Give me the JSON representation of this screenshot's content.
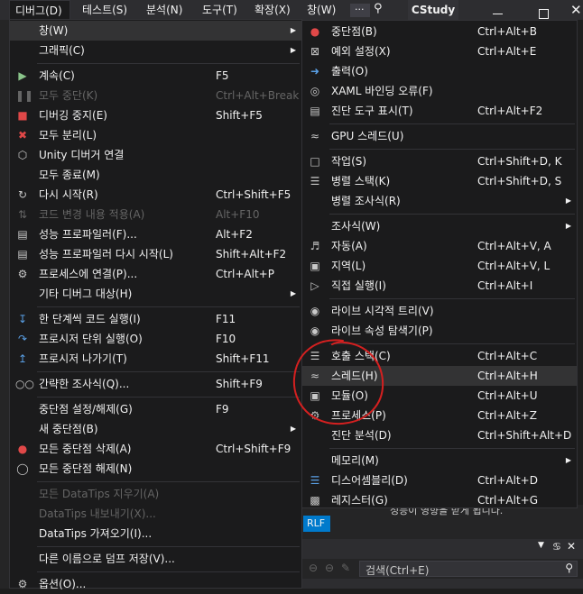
{
  "menubar": {
    "items": [
      {
        "label": "디버그(D)"
      },
      {
        "label": "테스트(S)"
      },
      {
        "label": "분석(N)"
      },
      {
        "label": "도구(T)"
      },
      {
        "label": "확장(X)"
      },
      {
        "label": "창(W)"
      }
    ],
    "search_ellipsis": "...",
    "solution_title": "CStudy"
  },
  "debug_menu": {
    "items": [
      {
        "label": "창(W)",
        "shortcut": "",
        "icon": "",
        "submenu": true,
        "highlight": true
      },
      {
        "label": "그래픽(C)",
        "shortcut": "",
        "icon": "",
        "submenu": true
      },
      {
        "sep": true
      },
      {
        "label": "계속(C)",
        "shortcut": "F5",
        "icon": "play-icon"
      },
      {
        "label": "모두 중단(K)",
        "shortcut": "Ctrl+Alt+Break",
        "icon": "pause-icon",
        "disabled": true
      },
      {
        "label": "디버깅 중지(E)",
        "shortcut": "Shift+F5",
        "icon": "stop-icon"
      },
      {
        "label": "모두 분리(L)",
        "shortcut": "",
        "icon": "detach-icon"
      },
      {
        "label": "Unity 디버거 연결",
        "shortcut": "",
        "icon": "unity-icon"
      },
      {
        "label": "모두 종료(M)",
        "shortcut": "",
        "icon": ""
      },
      {
        "label": "다시 시작(R)",
        "shortcut": "Ctrl+Shift+F5",
        "icon": "restart-icon"
      },
      {
        "label": "코드 변경 내용 적용(A)",
        "shortcut": "Alt+F10",
        "icon": "apply-changes-icon",
        "disabled": true
      },
      {
        "label": "성능 프로파일러(F)...",
        "shortcut": "Alt+F2",
        "icon": "profiler-icon"
      },
      {
        "label": "성능 프로파일러 다시 시작(L)",
        "shortcut": "Shift+Alt+F2",
        "icon": "profiler-restart-icon"
      },
      {
        "label": "프로세스에 연결(P)...",
        "shortcut": "Ctrl+Alt+P",
        "icon": "attach-process-icon"
      },
      {
        "label": "기타 디버그 대상(H)",
        "shortcut": "",
        "icon": "",
        "submenu": true
      },
      {
        "sep": true
      },
      {
        "label": "한 단계씩 코드 실행(I)",
        "shortcut": "F11",
        "icon": "step-into-icon"
      },
      {
        "label": "프로시저 단위 실행(O)",
        "shortcut": "F10",
        "icon": "step-over-icon"
      },
      {
        "label": "프로시저 나가기(T)",
        "shortcut": "Shift+F11",
        "icon": "step-out-icon"
      },
      {
        "sep": true
      },
      {
        "label": "간략한 조사식(Q)...",
        "shortcut": "Shift+F9",
        "icon": "quickwatch-icon"
      },
      {
        "sep": true
      },
      {
        "label": "중단점 설정/해제(G)",
        "shortcut": "F9",
        "icon": ""
      },
      {
        "label": "새 중단점(B)",
        "shortcut": "",
        "icon": "",
        "submenu": true
      },
      {
        "label": "모든 중단점 삭제(A)",
        "shortcut": "Ctrl+Shift+F9",
        "icon": "delete-breakpoints-icon"
      },
      {
        "label": "모든 중단점 해제(N)",
        "shortcut": "",
        "icon": "disable-breakpoints-icon"
      },
      {
        "sep": true
      },
      {
        "label": "모든 DataTips 지우기(A)",
        "shortcut": "",
        "icon": "",
        "disabled": true
      },
      {
        "label": "DataTips 내보내기(X)...",
        "shortcut": "",
        "icon": "",
        "disabled": true
      },
      {
        "label": "DataTips 가져오기(I)...",
        "shortcut": "",
        "icon": ""
      },
      {
        "sep": true
      },
      {
        "label": "다른 이름으로 덤프 저장(V)...",
        "shortcut": "",
        "icon": ""
      },
      {
        "sep": true
      },
      {
        "label": "옵션(O)...",
        "shortcut": "",
        "icon": "gear-icon"
      }
    ]
  },
  "windows_submenu": {
    "items": [
      {
        "label": "중단점(B)",
        "shortcut": "Ctrl+Alt+B",
        "icon": "breakpoints-icon"
      },
      {
        "label": "예외 설정(X)",
        "shortcut": "Ctrl+Alt+E",
        "icon": "exception-settings-icon"
      },
      {
        "label": "출력(O)",
        "shortcut": "",
        "icon": "output-icon"
      },
      {
        "label": "XAML 바인딩 오류(F)",
        "shortcut": "",
        "icon": "xaml-binding-icon"
      },
      {
        "label": "진단 도구 표시(T)",
        "shortcut": "Ctrl+Alt+F2",
        "icon": "diagnostic-tools-icon"
      },
      {
        "sep": true
      },
      {
        "label": "GPU 스레드(U)",
        "shortcut": "",
        "icon": "gpu-threads-icon"
      },
      {
        "sep": true
      },
      {
        "label": "작업(S)",
        "shortcut": "Ctrl+Shift+D, K",
        "icon": "tasks-icon"
      },
      {
        "label": "병렬 스택(K)",
        "shortcut": "Ctrl+Shift+D, S",
        "icon": "parallel-stacks-icon"
      },
      {
        "label": "병렬 조사식(R)",
        "shortcut": "",
        "icon": "",
        "submenu": true
      },
      {
        "sep": true
      },
      {
        "label": "조사식(W)",
        "shortcut": "",
        "icon": "",
        "submenu": true
      },
      {
        "label": "자동(A)",
        "shortcut": "Ctrl+Alt+V, A",
        "icon": "autos-icon"
      },
      {
        "label": "지역(L)",
        "shortcut": "Ctrl+Alt+V, L",
        "icon": "locals-icon"
      },
      {
        "label": "직접 실행(I)",
        "shortcut": "Ctrl+Alt+I",
        "icon": "immediate-icon"
      },
      {
        "sep": true
      },
      {
        "label": "라이브 시각적 트리(V)",
        "shortcut": "",
        "icon": "camera-icon"
      },
      {
        "label": "라이브 속성 탐색기(P)",
        "shortcut": "",
        "icon": "camera-icon"
      },
      {
        "sep": true
      },
      {
        "label": "호출 스택(C)",
        "shortcut": "Ctrl+Alt+C",
        "icon": "call-stack-icon"
      },
      {
        "label": "스레드(H)",
        "shortcut": "Ctrl+Alt+H",
        "icon": "threads-icon",
        "highlight": true
      },
      {
        "label": "모듈(O)",
        "shortcut": "Ctrl+Alt+U",
        "icon": "modules-icon"
      },
      {
        "label": "프로세스(P)",
        "shortcut": "Ctrl+Alt+Z",
        "icon": "processes-icon"
      },
      {
        "label": "진단 분석(D)",
        "shortcut": "Ctrl+Shift+Alt+D",
        "icon": ""
      },
      {
        "sep": true
      },
      {
        "label": "메모리(M)",
        "shortcut": "",
        "icon": "",
        "submenu": true
      },
      {
        "label": "디스어셈블리(D)",
        "shortcut": "Ctrl+Alt+D",
        "icon": "disassembly-icon"
      },
      {
        "label": "레지스터(G)",
        "shortcut": "Ctrl+Alt+G",
        "icon": "registers-icon"
      }
    ]
  },
  "background": {
    "status_text": "성능이 영향을 받게 됩니다.",
    "crlf": "RLF",
    "search_placeholder": "검색(Ctrl+E)"
  },
  "colors": {
    "menu_bg": "#1b1b1c",
    "highlight": "#333334",
    "annotation_red": "#d42020"
  }
}
